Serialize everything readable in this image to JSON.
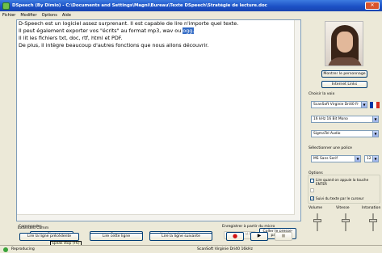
{
  "window": {
    "title": "DSpeech (By Dimio) - C:\\Documents and Settings\\Magni\\Bureau\\Texte DSpeech\\Stratégie de lecture.doc"
  },
  "menu": [
    "Fichier",
    "Modifier",
    "Options",
    "Aide"
  ],
  "editor": {
    "lines": [
      "D-Speech est un logiciel assez surprenant. Il est capable de lire n'importe quel texte.",
      "Il peut également exporter vos \"écrits\" au format mp3, wav ou ",
      "Il lit les fichiers txt, doc, rtf, html et  PDF.",
      "De plus, il intègre beaucoup d'autres fonctions que nous allons découvrir."
    ],
    "highlight": "ogg."
  },
  "right_panel": {
    "show_character": "Montrer le personnage",
    "internet_links": "Internet Links",
    "choose_voice_label": "Choisir la voix",
    "voice": "ScanSoft Virginie Dri40 Fr",
    "audio_format": "16 kHz 16 Bit Mono",
    "audio_output": "SigmaTel Audio",
    "font_label": "Sélectionner une police",
    "font": "MS Sans Serif",
    "font_size": "12",
    "options_label": "Options",
    "option1": "Lire quand on appuie la touche ENTER",
    "option2": "",
    "option3": "Suivi du texte par le curseur",
    "option3_checked": "✓",
    "volume": "Volume",
    "speed": "Vitesse",
    "intonation": "Intonation"
  },
  "bottom": {
    "commands_label": "Commandes",
    "stop": "Stop",
    "tooltip": "Speak stop (F6)",
    "pause": "Pause",
    "read_from_cursor": "Lire à partir du curseur",
    "convert_mp3": "Convertir MP3",
    "paste_clipboard": "Coller le presse-papiers",
    "extended": "Extended Comm",
    "prev_line": "Lire la ligne précédente",
    "this_line": "Lire cette ligne",
    "next_line": "Lire la ligne suivante",
    "record_label": "Enregistrer à partir du micro",
    "rec": "●",
    "play": "▶",
    "stop_rec": "■"
  },
  "status": {
    "state": "Reproducing",
    "voice": "ScanSoft Virginie Dri40 16kHz"
  },
  "colors": {
    "titlebar": "#1b4fc4",
    "highlight": "#316ac5",
    "record": "#d21010"
  }
}
